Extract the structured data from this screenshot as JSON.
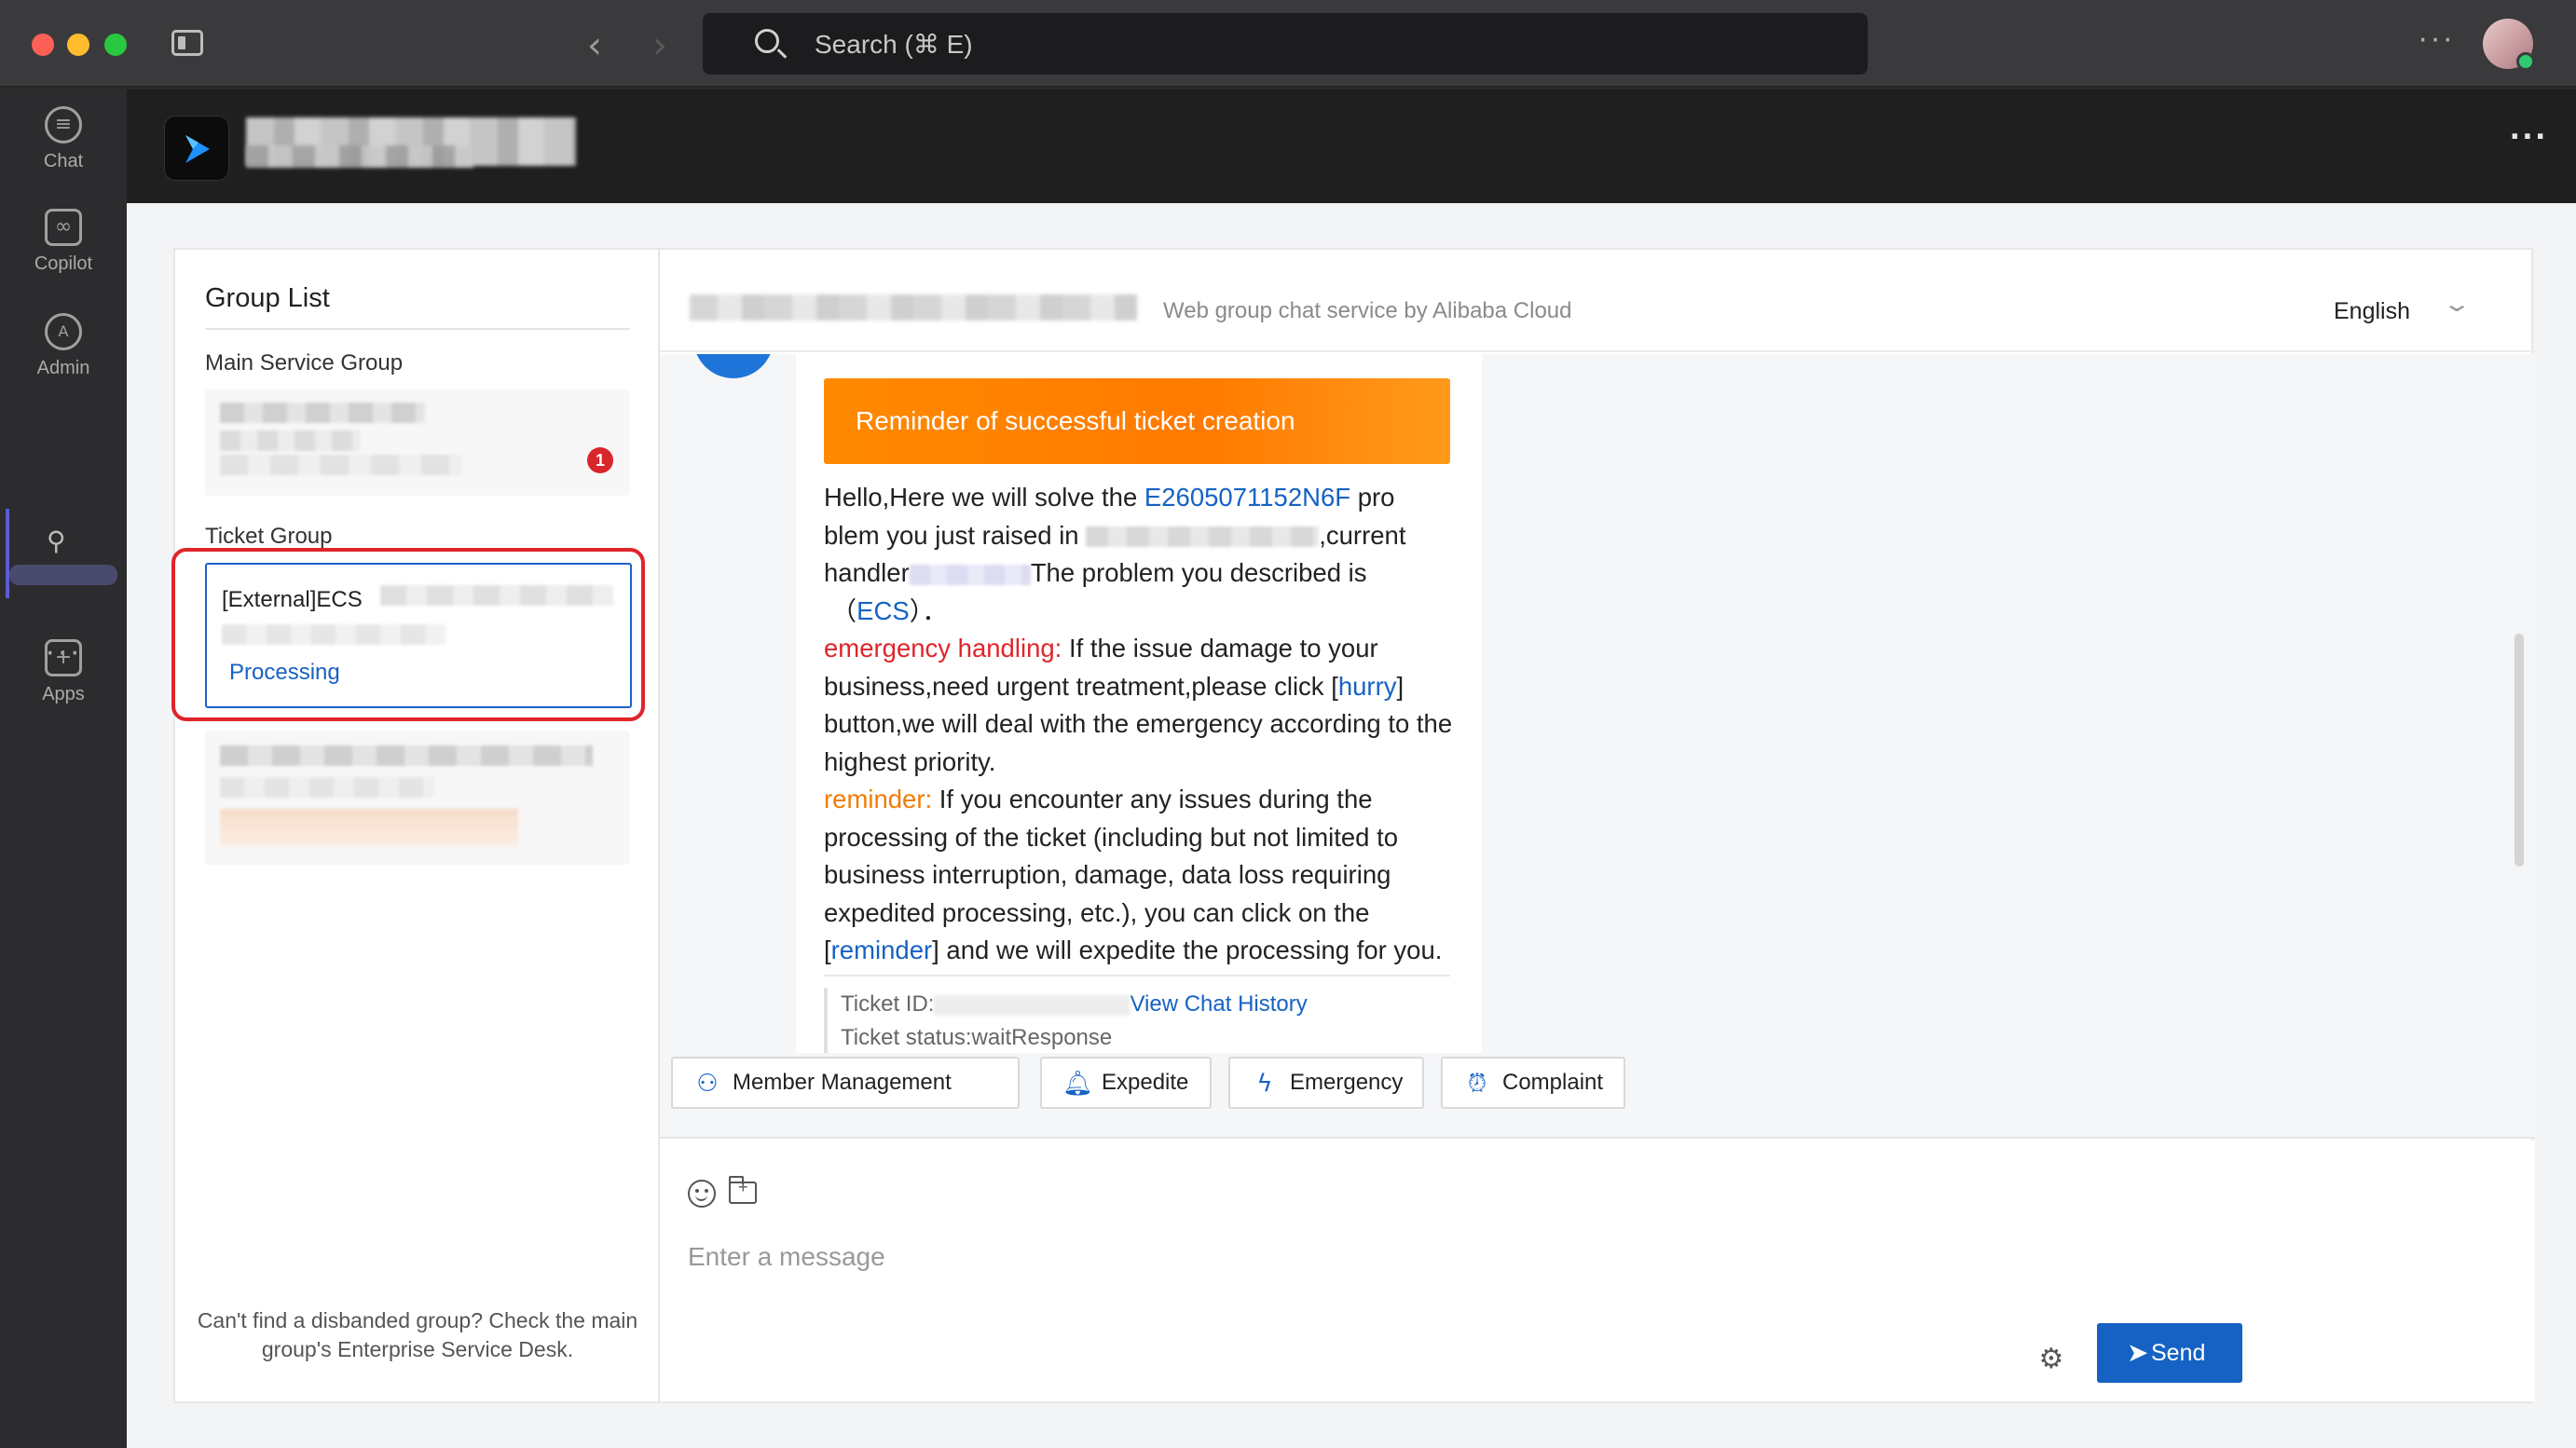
{
  "titlebar": {
    "search_placeholder": "Search (⌘ E)",
    "more_label": "···"
  },
  "rail": {
    "items": [
      {
        "label": "Chat",
        "icon": "chat-icon"
      },
      {
        "label": "Copilot",
        "icon": "copilot-icon"
      },
      {
        "label": "Admin",
        "icon": "admin-icon"
      },
      {
        "label": "Apps",
        "icon": "add-apps-icon"
      }
    ],
    "more_label": "···"
  },
  "app_header": {
    "more_label": "···"
  },
  "group_list": {
    "title": "Group List",
    "main_section": "Main Service Group",
    "main_badge": "1",
    "ticket_section": "Ticket Group",
    "active_ticket": {
      "title": "[External]ECS",
      "status": "Processing"
    },
    "footer": "Can't find a disbanded group? Check the main group's Enterprise Service Desk."
  },
  "chat": {
    "subtitle": "Web group chat service by Alibaba Cloud",
    "language": "English",
    "message": {
      "banner": "Reminder of successful ticket creation",
      "greeting_prefix": "Hello,Here we will solve the ",
      "ticket_link": "E2605071152N6F",
      "line1_suffix": " pro",
      "line2": "blem you just raised in ",
      "line2_suffix": ",current",
      "line3": "handler",
      "line3_suffix": "The problem you described is",
      "product_open": "（",
      "product_link": "ECS",
      "product_close": "）．",
      "emergency_label": "emergency handling:",
      "emergency_text": " If the issue damage to your business,need urgent treatment,please click [",
      "hurry_link": "hurry",
      "emergency_text2": "] button,we will deal with the emergency according to the highest priority.",
      "reminder_label": "reminder:",
      "reminder_text": " If you encounter any issues during the processing of the ticket (including but not limited to business interruption, damage, data loss requiring expedited processing, etc.), you can click on the [",
      "reminder_link": "reminder",
      "reminder_text2": "] and we will expedite the processing for you.",
      "ticket_id_label": "Ticket ID:",
      "view_history": "View Chat History",
      "ticket_status": "Ticket status:waitResponse"
    },
    "actions": [
      {
        "label": "Member Management",
        "icon": "person-icon"
      },
      {
        "label": "Expedite",
        "icon": "bell-icon"
      },
      {
        "label": "Emergency",
        "icon": "lightning-icon"
      },
      {
        "label": "Complaint",
        "icon": "alarm-icon"
      }
    ],
    "composer": {
      "placeholder": "Enter a message",
      "send_label": "Send"
    }
  },
  "colors": {
    "accent": "#1662c4",
    "banner": "#ff8a00",
    "highlight": "#e0242b"
  }
}
